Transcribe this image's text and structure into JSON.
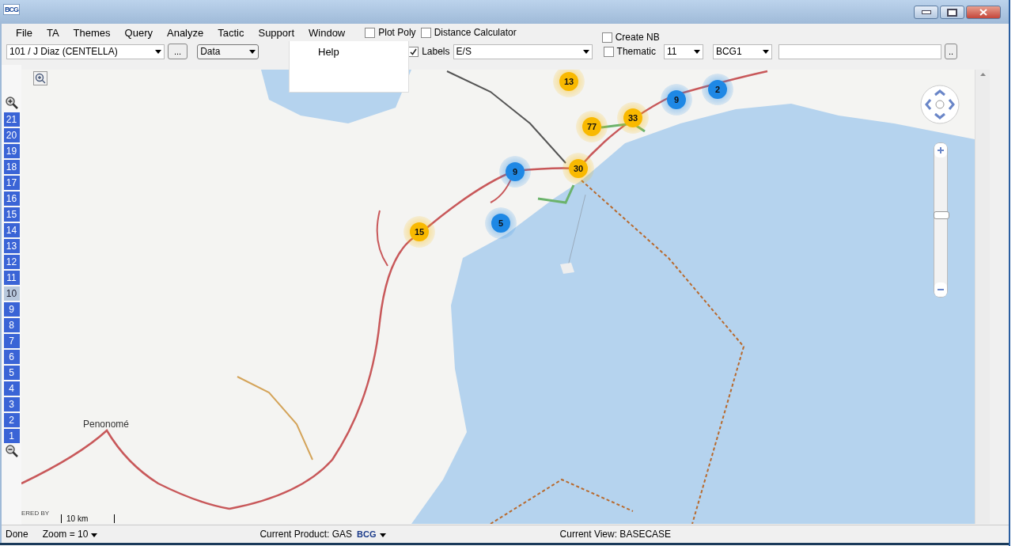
{
  "window": {
    "logo": "BCG"
  },
  "menu": [
    {
      "label": "File"
    },
    {
      "label": "TA"
    },
    {
      "label": "Themes"
    },
    {
      "label": "Query"
    },
    {
      "label": "Analyze"
    },
    {
      "label": "Tactic"
    },
    {
      "label": "Support"
    },
    {
      "label": "Window"
    }
  ],
  "open_menu": {
    "items": [
      "Help"
    ]
  },
  "toolbar": {
    "territory": "101 / J Diaz (CENTELLA)",
    "browse_button": "...",
    "layer": "Data",
    "checkboxes": [
      {
        "label": "Plot Poly",
        "checked": false
      },
      {
        "label": "Distance Calculator",
        "checked": false
      },
      {
        "label": "Create NB",
        "checked": false
      },
      {
        "label": "Labels",
        "checked": true
      },
      {
        "label": "Thematic",
        "checked": false
      }
    ],
    "labels_value": "E/S",
    "thematic_value": "11",
    "segment": "BCG1",
    "extra_button": ".."
  },
  "zoom_levels": [
    {
      "label": "21",
      "selected": false
    },
    {
      "label": "20",
      "selected": false
    },
    {
      "label": "19",
      "selected": false
    },
    {
      "label": "18",
      "selected": false
    },
    {
      "label": "17",
      "selected": false
    },
    {
      "label": "16",
      "selected": false
    },
    {
      "label": "15",
      "selected": false
    },
    {
      "label": "14",
      "selected": false
    },
    {
      "label": "13",
      "selected": false
    },
    {
      "label": "12",
      "selected": false
    },
    {
      "label": "11",
      "selected": false
    },
    {
      "label": "10",
      "selected": true
    },
    {
      "label": "9",
      "selected": false
    },
    {
      "label": "8",
      "selected": false
    },
    {
      "label": "7",
      "selected": false
    },
    {
      "label": "6",
      "selected": false
    },
    {
      "label": "5",
      "selected": false
    },
    {
      "label": "4",
      "selected": false
    },
    {
      "label": "3",
      "selected": false
    },
    {
      "label": "2",
      "selected": false
    },
    {
      "label": "1",
      "selected": false
    }
  ],
  "map": {
    "place_label": "Penonomé",
    "attribution": "ERED BY",
    "scale": "10 km",
    "clusters": [
      {
        "count": "13",
        "color": "#f9b900"
      },
      {
        "count": "2",
        "color": "#1e88e5"
      },
      {
        "count": "9",
        "color": "#1e88e5"
      },
      {
        "count": "77",
        "color": "#f9b900"
      },
      {
        "count": "33",
        "color": "#f9b900"
      },
      {
        "count": "9",
        "color": "#1e88e5"
      },
      {
        "count": "30",
        "color": "#f9b900"
      },
      {
        "count": "5",
        "color": "#1e88e5"
      },
      {
        "count": "15",
        "color": "#f9b900"
      }
    ]
  },
  "zoom_slider": {
    "level": 0.55
  },
  "status_bar": {
    "state": "Done",
    "zoom": "Zoom = 10",
    "product": "Current Product: GAS",
    "product_logo": "BCG",
    "view": "Current View: BASECASE"
  }
}
